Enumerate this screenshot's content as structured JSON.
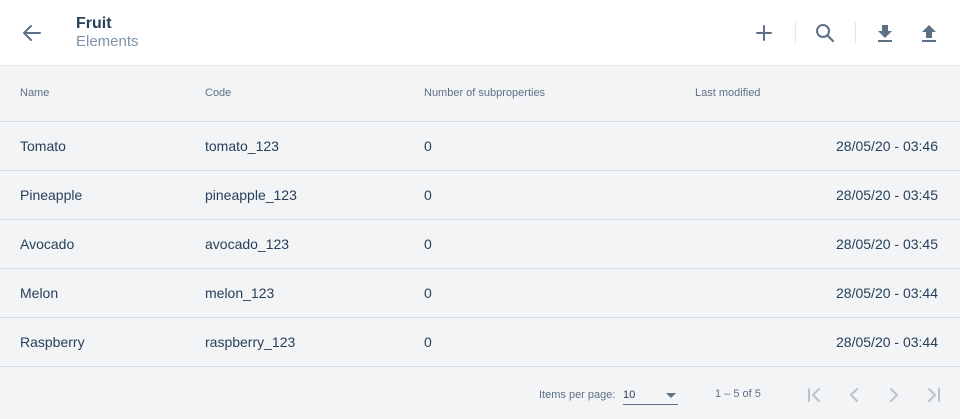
{
  "header": {
    "title": "Fruit",
    "subtitle": "Elements",
    "icons": [
      "arrow-left-icon",
      "plus-icon",
      "search-icon",
      "download-icon",
      "upload-icon"
    ]
  },
  "table": {
    "columns": [
      "Name",
      "Code",
      "Number of subproperties",
      "Last modified"
    ],
    "rows": [
      {
        "name": "Tomato",
        "code": "tomato_123",
        "subproperties": "0",
        "modified": "28/05/20 - 03:46"
      },
      {
        "name": "Pineapple",
        "code": "pineapple_123",
        "subproperties": "0",
        "modified": "28/05/20 - 03:45"
      },
      {
        "name": "Avocado",
        "code": "avocado_123",
        "subproperties": "0",
        "modified": "28/05/20 - 03:45"
      },
      {
        "name": "Melon",
        "code": "melon_123",
        "subproperties": "0",
        "modified": "28/05/20 - 03:44"
      },
      {
        "name": "Raspberry",
        "code": "raspberry_123",
        "subproperties": "0",
        "modified": "28/05/20 - 03:44"
      }
    ]
  },
  "paginator": {
    "items_per_page_label": "Items per page:",
    "items_per_page_value": "10",
    "range_label": "1 – 5 of 5",
    "icons": [
      "first-page-icon",
      "previous-page-icon",
      "next-page-icon",
      "last-page-icon"
    ]
  },
  "colors": {
    "text": "#27405a",
    "muted": "#7f93a6",
    "icon": "#5d7086",
    "border": "#d5dadf",
    "background": "#f3f4f6",
    "header_bg": "#ffffff"
  }
}
